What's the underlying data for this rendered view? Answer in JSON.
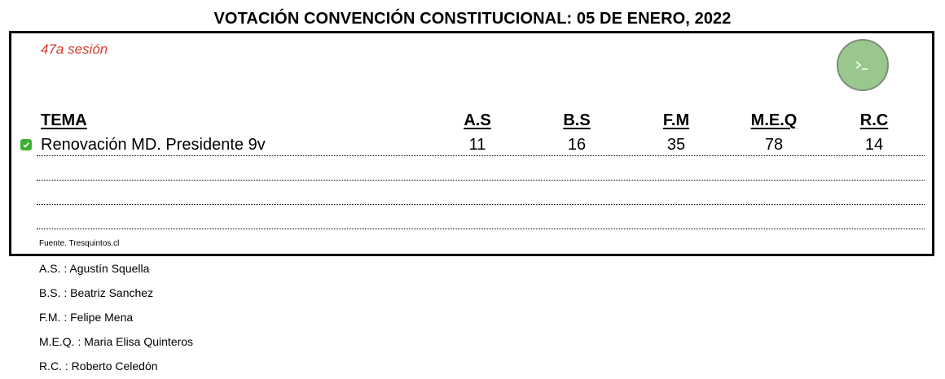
{
  "title": "VOTACIÓN CONVENCIÓN CONSTITUCIONAL: 05 DE ENERO, 2022",
  "session": "47a sesión",
  "terminal_button_icon": "terminal-icon",
  "check_icon": "check-icon",
  "colors": {
    "session": "#d8382e",
    "check": "#3fae35",
    "terminal_button": "#9ac78d"
  },
  "table": {
    "headers": [
      "TEMA",
      "A.S",
      "B.S",
      "F.M",
      "M.E.Q",
      "R.C"
    ],
    "rows": [
      {
        "topic": "Renovación MD.  Presidente 9v",
        "values": [
          "11",
          "16",
          "35",
          "78",
          "14"
        ],
        "checked": true
      }
    ]
  },
  "source": "Fuente. Tresquintos.cl",
  "legend": [
    "A.S. : Agustín Squella",
    "B.S. : Beatriz Sanchez",
    "F.M. : Felipe Mena",
    "M.E.Q. : Maria Elisa Quinteros",
    "R.C. : Roberto Celedón"
  ]
}
